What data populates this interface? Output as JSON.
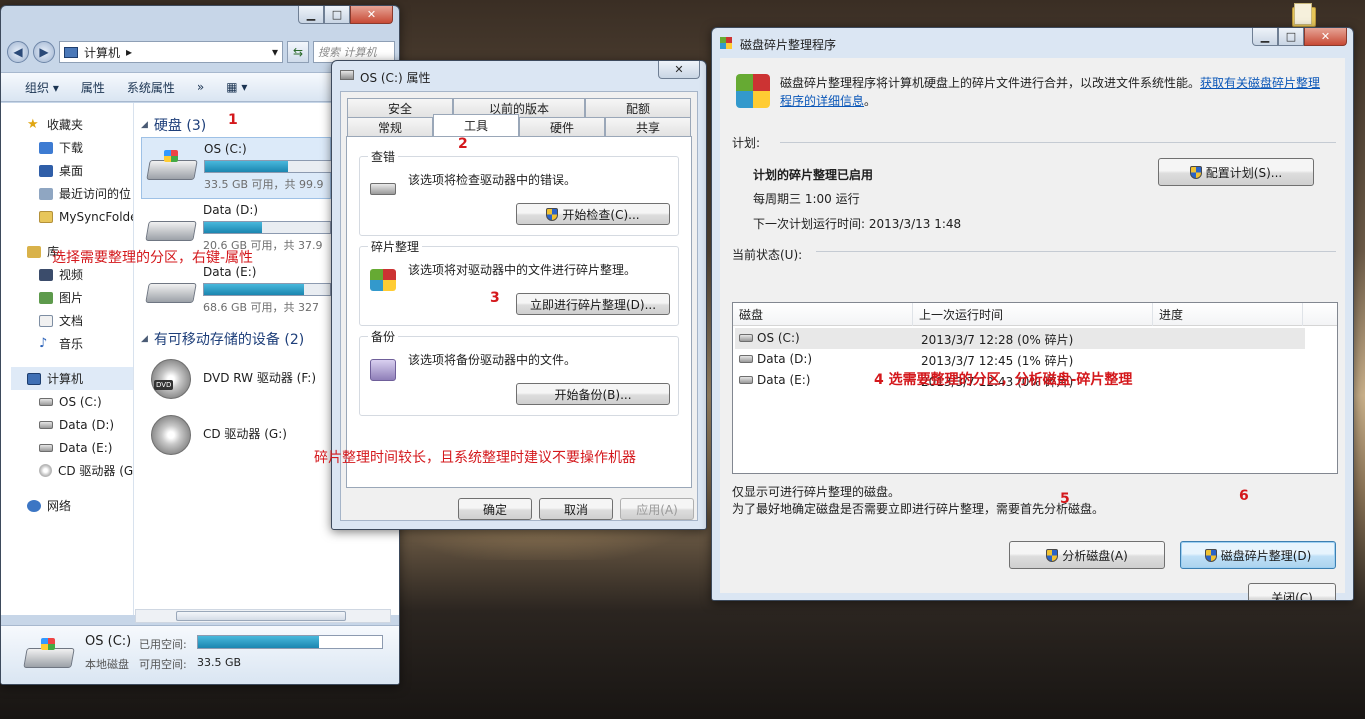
{
  "explorer": {
    "path": "计算机",
    "search_placeholder": "搜索 计算机",
    "toolbar": [
      "组织 ▾",
      "属性",
      "系统属性",
      "»"
    ],
    "nav": {
      "favorites": "收藏夹",
      "downloads": "下载",
      "desktop": "桌面",
      "recent": "最近访问的位",
      "mysync": "MySyncFolde",
      "libraries": "库",
      "videos": "视频",
      "pictures": "图片",
      "documents": "文档",
      "music": "音乐",
      "computer": "计算机",
      "os_c": "OS (C:)",
      "data_d": "Data (D:)",
      "data_e": "Data (E:)",
      "cd_g": "CD 驱动器 (G",
      "network": "网络"
    },
    "hard_disks_header": "硬盘 (3)",
    "drives": [
      {
        "name": "OS (C:)",
        "free": "33.5 GB 可用，共 99.9",
        "used_fraction": 0.66
      },
      {
        "name": "Data (D:)",
        "free": "20.6 GB 可用，共 37.9",
        "used_fraction": 0.46
      },
      {
        "name": "Data (E:)",
        "free": "68.6 GB 可用，共 327",
        "used_fraction": 0.79
      }
    ],
    "removable_header": "有可移动存储的设备 (2)",
    "removable": [
      {
        "name": "DVD RW 驱动器 (F:)",
        "badge": "DVD"
      },
      {
        "name": "CD 驱动器 (G:)"
      }
    ],
    "details": {
      "name": "OS (C:)",
      "type": "本地磁盘",
      "used_label": "已用空间:",
      "free_label": "可用空间:",
      "free_value": "33.5 GB",
      "used_fraction": 0.66
    }
  },
  "props": {
    "title": "OS (C:) 属性",
    "tabs_row1": [
      "安全",
      "以前的版本",
      "配额"
    ],
    "tabs_row2": [
      "常规",
      "工具",
      "硬件",
      "共享"
    ],
    "active_tab": "工具",
    "check": {
      "legend": "查错",
      "text": "该选项将检查驱动器中的错误。",
      "button": "开始检查(C)..."
    },
    "defrag": {
      "legend": "碎片整理",
      "text": "该选项将对驱动器中的文件进行碎片整理。",
      "button": "立即进行碎片整理(D)..."
    },
    "backup": {
      "legend": "备份",
      "text": "该选项将备份驱动器中的文件。",
      "button": "开始备份(B)..."
    },
    "ok": "确定",
    "cancel": "取消",
    "apply": "应用(A)"
  },
  "defrag": {
    "title": "磁盘碎片整理程序",
    "header_text": "磁盘碎片整理程序将计算机硬盘上的碎片文件进行合并，以改进文件系统性能。",
    "header_link": "获取有关磁盘碎片整理程序的详细信息",
    "header_tail": "。",
    "schedule_label": "计划:",
    "schedule_enabled": "计划的碎片整理已启用",
    "schedule_run": "每周期三  1:00 运行",
    "schedule_next": "下一次计划运行时间: 2013/3/13 1:48",
    "configure_button": "配置计划(S)...",
    "status_label": "当前状态(U):",
    "columns": [
      "磁盘",
      "上一次运行时间",
      "进度"
    ],
    "rows": [
      {
        "disk": "OS (C:)",
        "last_run": "2013/3/7 12:28 (0% 碎片)"
      },
      {
        "disk": "Data (D:)",
        "last_run": "2013/3/7 12:45 (1% 碎片)"
      },
      {
        "disk": "Data (E:)",
        "last_run": "2013/3/7 12:43 (0% 碎片)"
      }
    ],
    "note1": "仅显示可进行碎片整理的磁盘。",
    "note2": "为了最好地确定磁盘是否需要立即进行碎片整理，需要首先分析磁盘。",
    "analyze_button": "分析磁盘(A)",
    "defrag_button": "磁盘碎片整理(D)",
    "close_button": "关闭(C)"
  },
  "annotations": {
    "n1": "1",
    "n2": "2",
    "n3": "3",
    "step1_text": "选择需要整理的分区，右键-属性",
    "long_time_text": "碎片整理时间较长，且系统整理时建议不要操作机器",
    "step4_text": "4    选需要整理的分区，分析磁盘-碎片整理",
    "n5": "5",
    "n6": "6"
  },
  "colors": {
    "annotation": "#d4181c",
    "link": "#0b57b8",
    "usage_bar": "#1b86b0"
  }
}
